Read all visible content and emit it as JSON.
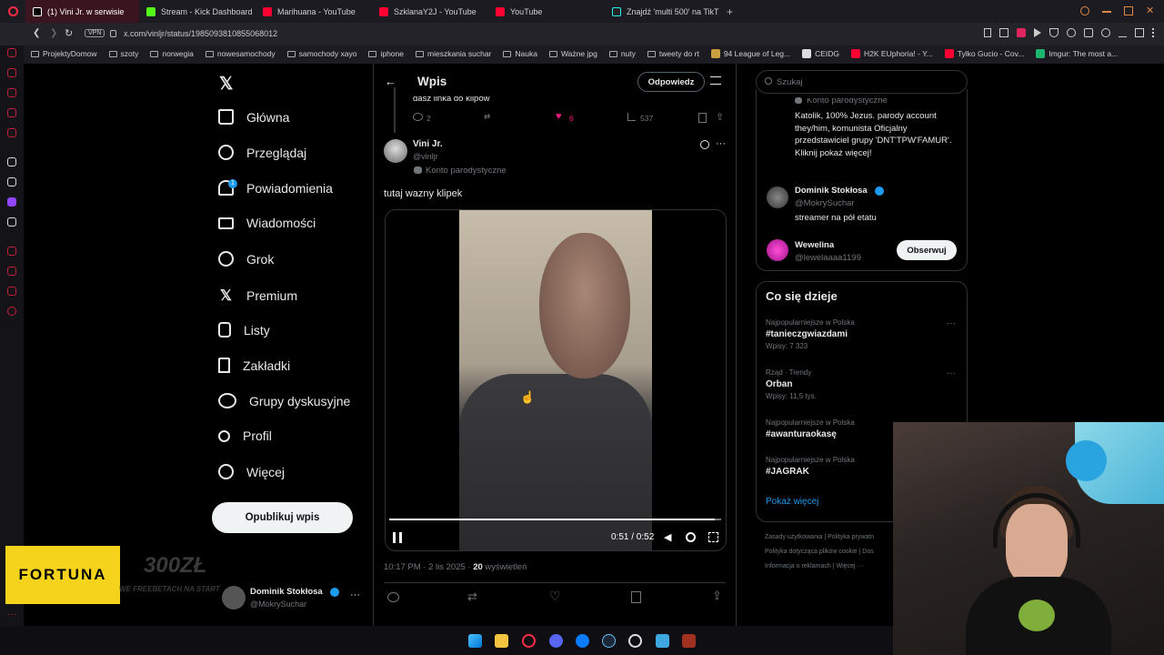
{
  "browser": {
    "tabs": [
      {
        "label": "(1) Vini Jr. w serwisie",
        "color": "#e7e9ea",
        "active": true
      },
      {
        "label": "Stream - Kick Dashboard",
        "color": "#53fc18"
      },
      {
        "label": "Marihuana - YouTube",
        "color": "#ff0033"
      },
      {
        "label": "SzklanaY2J - YouTube",
        "color": "#ff0033"
      },
      {
        "label": "YouTube",
        "color": "#ff0033"
      },
      {
        "label": "Znajdź 'multi 500' na TikT",
        "color": "#e7e9ea"
      }
    ],
    "new_tab": "+",
    "vpn": "VPN",
    "url": "x.com/vinljr/status/1985093810855068012",
    "bookmarks": [
      "ProjektyDomow",
      "szoty",
      "norwegia",
      "nowesamochody",
      "samochody xayo",
      "iphone",
      "mieszkania suchar",
      "Nauka",
      "Ważne jpg",
      "nuty",
      "tweety do rt",
      "94 League of Leg...",
      "CEIDG",
      "H2K EUphoria! - Y...",
      "Tylko Gucio - Cov...",
      "Imgur: The most a..."
    ]
  },
  "nav": {
    "items": [
      "Główna",
      "Przeglądaj",
      "Powiadomienia",
      "Wiadomości",
      "Grok",
      "Premium",
      "Listy",
      "Zakładki",
      "Grupy dyskusyjne",
      "Profil",
      "Więcej"
    ],
    "notif_badge": "1",
    "publish": "Opublikuj wpis",
    "account_name": "Dominik Stokłosa",
    "account_handle": "@MokrySuchar"
  },
  "header": {
    "title": "Wpis",
    "reply": "Odpowiedz"
  },
  "prev_tweet": {
    "text": "dasz linka do klipów",
    "replies": "2",
    "likes": "6",
    "views": "537"
  },
  "tweet": {
    "name": "Vini Jr.",
    "handle": "@vinljr",
    "label": "Konto parodystyczne",
    "text": "tutaj wazny klipek",
    "time": "0:51 / 0:52",
    "progress": 0.98,
    "meta_date": "10:17 PM · 2 lis 2025 · ",
    "meta_views": "20",
    "meta_views_label": " wyświetleń"
  },
  "right": {
    "search_placeholder": "Szukaj",
    "bio_label": "Konto parodystyczne",
    "bio": "Katolik, 100% Jezus. parody account they/him, komunista Oficjalny przedstawiciel grupy 'DNT'TPW'FAMUR'. Kliknij pokaż więcej!",
    "who1_name": "Dominik Stokłosa",
    "who1_handle": "@MokrySuchar",
    "who1_bio": "streamer na pół etatu",
    "who2_name": "Wewelina",
    "who2_handle": "@lewelaaaa1199",
    "follow": "Obserwuj",
    "trends_title": "Co się dzieje",
    "trends": [
      {
        "ctx": "Najpopularniejsze w Polska",
        "name": "#tanieczgwiazdami",
        "count": "Wpisy: 7 323"
      },
      {
        "ctx": "Rząd · Trendy",
        "name": "Orban",
        "count": "Wpisy: 11,5 tys."
      },
      {
        "ctx": "Najpopularniejsze w Polska",
        "name": "#awanturaokasę",
        "count": ""
      },
      {
        "ctx": "Najpopularniejsze w Polska",
        "name": "#JAGRAK",
        "count": ""
      }
    ],
    "show_more": "Pokaż więcej",
    "footer1": "Zasady użytkowania",
    "footer2": "Polityka prywatn",
    "footer3": "Polityka dotycząca plików cookie",
    "footer4": "Dos",
    "footer5": "Informacja o reklamach",
    "footer6": "Więcej ···"
  },
  "ad": {
    "brand": "FORTUNA",
    "amount": "300ZŁ",
    "tagline": "WE FREEBETACH NA START"
  }
}
